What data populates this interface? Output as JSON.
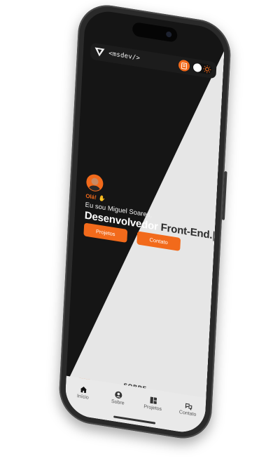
{
  "navbar": {
    "brand": "<msdev/>",
    "logo_icon": "ms-logo-icon",
    "cv_icon": "document-icon",
    "theme_toggle_icon": "sun-icon"
  },
  "hero": {
    "greeting": "Olá!",
    "greeting_icon": "waving-hand-icon",
    "intro": "Eu sou Miguel Soares,",
    "headline_part_dark": "Desenvolvedor",
    "headline_part_light": " Front-End.",
    "caret": "|",
    "buttons": [
      {
        "label": "Projetos"
      },
      {
        "label": "Contato"
      }
    ]
  },
  "next_section_peek": "SOBRE",
  "tabs": [
    {
      "label": "Início",
      "icon": "home-icon"
    },
    {
      "label": "Sobre",
      "icon": "user-icon"
    },
    {
      "label": "Projetos",
      "icon": "grid-icon"
    },
    {
      "label": "Contato",
      "icon": "chat-icon"
    }
  ],
  "colors": {
    "accent": "#f26a1b",
    "dark_bg": "#151515",
    "light_bg": "#e6e6e6"
  }
}
